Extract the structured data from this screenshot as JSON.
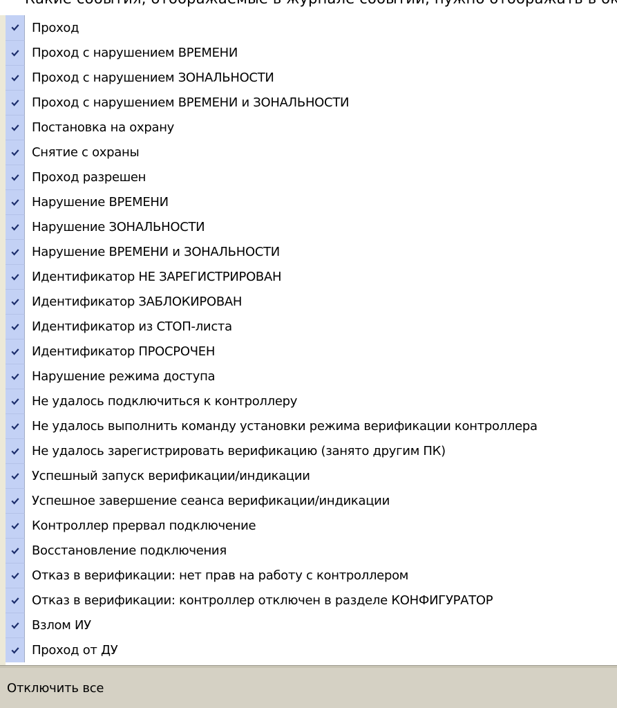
{
  "header": {
    "partial_text": "Какие события, отображаемые в журнале событий, нужно отображать в окне мониторинга"
  },
  "checkbox_color": "#c3d1f5",
  "checkmark_color": "#1c2e6c",
  "events": {
    "items": [
      {
        "label": "Проход",
        "checked": true
      },
      {
        "label": "Проход с нарушением ВРЕМЕНИ",
        "checked": true
      },
      {
        "label": "Проход с нарушением ЗОНАЛЬНОСТИ",
        "checked": true
      },
      {
        "label": "Проход с нарушением ВРЕМЕНИ и ЗОНАЛЬНОСТИ",
        "checked": true
      },
      {
        "label": "Постановка на охрану",
        "checked": true
      },
      {
        "label": "Снятие с охраны",
        "checked": true
      },
      {
        "label": "Проход разрешен",
        "checked": true
      },
      {
        "label": "Нарушение ВРЕМЕНИ",
        "checked": true
      },
      {
        "label": "Нарушение ЗОНАЛЬНОСТИ",
        "checked": true
      },
      {
        "label": "Нарушение ВРЕМЕНИ и ЗОНАЛЬНОСТИ",
        "checked": true
      },
      {
        "label": "Идентификатор НЕ ЗАРЕГИСТРИРОВАН",
        "checked": true
      },
      {
        "label": "Идентификатор ЗАБЛОКИРОВАН",
        "checked": true
      },
      {
        "label": "Идентификатор из СТОП-листа",
        "checked": true
      },
      {
        "label": "Идентификатор ПРОСРОЧЕН",
        "checked": true
      },
      {
        "label": "Нарушение режима доступа",
        "checked": true
      },
      {
        "label": "Не удалось подключиться к контроллеру",
        "checked": true
      },
      {
        "label": "Не удалось выполнить команду установки режима верификации контроллера",
        "checked": true
      },
      {
        "label": "Не удалось зарегистрировать верификацию (занято другим ПК)",
        "checked": true
      },
      {
        "label": "Успешный запуск верификации/индикации",
        "checked": true
      },
      {
        "label": "Успешное завершение сеанса верификации/индикации",
        "checked": true
      },
      {
        "label": "Контроллер прервал подключение",
        "checked": true
      },
      {
        "label": "Восстановление подключения",
        "checked": true
      },
      {
        "label": "Отказ в верификации: нет прав на работу с контроллером",
        "checked": true
      },
      {
        "label": "Отказ в верификации: контроллер отключен в разделе КОНФИГУРАТОР",
        "checked": true
      },
      {
        "label": "Взлом ИУ",
        "checked": true
      },
      {
        "label": "Проход от ДУ",
        "checked": true
      }
    ]
  },
  "footer": {
    "disable_all_label": "Отключить все"
  }
}
